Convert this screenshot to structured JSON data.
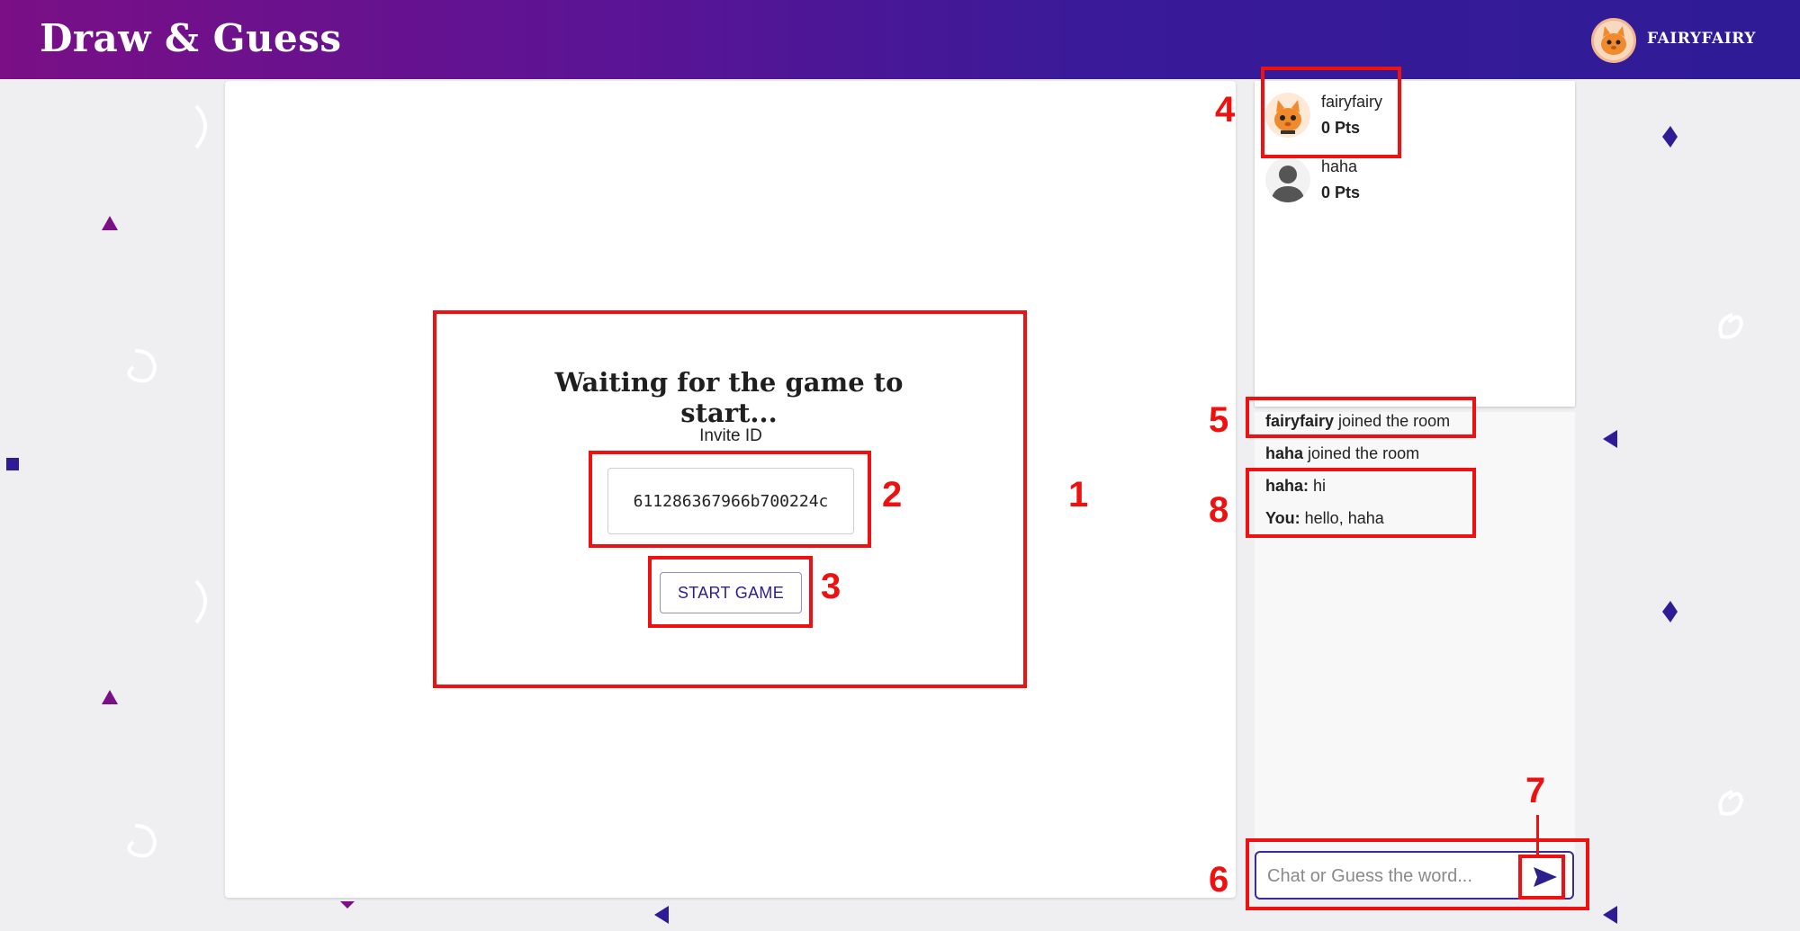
{
  "header": {
    "app_title": "Draw & Guess",
    "username": "FAIRYFAIRY",
    "avatar_icon": "cat-avatar-icon"
  },
  "waiting": {
    "title": "Waiting for the game to start...",
    "invite_label": "Invite ID",
    "invite_id": "611286367966b700224c",
    "start_button": "START GAME"
  },
  "players": [
    {
      "name": "fairyfairy",
      "points": "0 Pts",
      "avatar": "cat-avatar-icon"
    },
    {
      "name": "haha",
      "points": "0 Pts",
      "avatar": "default-user-icon"
    }
  ],
  "chat": {
    "messages": [
      {
        "sender": "fairyfairy",
        "text": " joined the room"
      },
      {
        "sender": "haha",
        "text": " joined the room"
      },
      {
        "sender": "haha:",
        "text": " hi"
      },
      {
        "sender": "You:",
        "text": " hello, haha"
      }
    ],
    "input_placeholder": "Chat or Guess the word...",
    "send_icon": "send-icon"
  },
  "annotations": [
    "1",
    "2",
    "3",
    "4",
    "5",
    "6",
    "7",
    "8"
  ],
  "colors": {
    "annotation": "#ee1111",
    "header_start": "#7a0f86",
    "header_end": "#2f1b96",
    "accent": "#2e1f8f"
  }
}
